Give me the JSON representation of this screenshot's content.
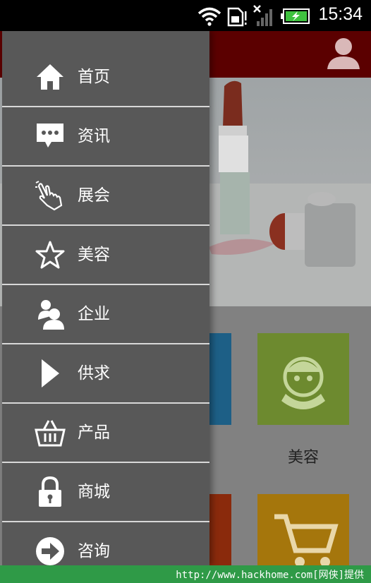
{
  "status_bar": {
    "time": "15:34",
    "icons": [
      "wifi-icon",
      "sim-card-icon",
      "signal-icon",
      "battery-charging-icon"
    ]
  },
  "background_app": {
    "header_icon": "user-icon",
    "banner": "lipstick-image",
    "tiles": [
      {
        "label": "美容",
        "icon": "face-mask-icon",
        "color": "#8bab3e"
      },
      {
        "icon": "shopping-cart-icon",
        "color": "#e6a716"
      }
    ]
  },
  "drawer": {
    "items": [
      {
        "label": "首页",
        "icon": "home-icon"
      },
      {
        "label": "资讯",
        "icon": "chat-bubble-icon"
      },
      {
        "label": "展会",
        "icon": "hand-pointer-icon"
      },
      {
        "label": "美容",
        "icon": "star-icon"
      },
      {
        "label": "企业",
        "icon": "people-icon"
      },
      {
        "label": "供求",
        "icon": "play-icon"
      },
      {
        "label": "产品",
        "icon": "basket-icon"
      },
      {
        "label": "商城",
        "icon": "lock-icon"
      },
      {
        "label": "咨询",
        "icon": "arrow-right-circle-icon"
      }
    ]
  },
  "watermark": "http://www.hackhome.com[网侠]提供",
  "colors": {
    "drawer_bg": "#585858",
    "app_bar": "#5b0000",
    "divider": "#d8d8d8",
    "watermark_bg": "#2f9a47"
  }
}
